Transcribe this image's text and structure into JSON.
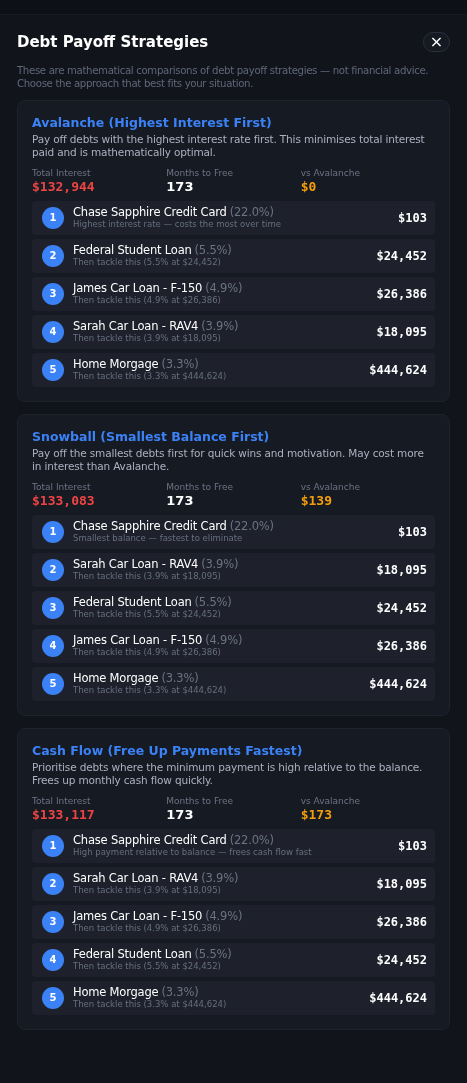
{
  "dialog": {
    "title": "Debt Payoff Strategies",
    "close": "×",
    "subtitle": "These are mathematical comparisons of debt payoff strategies — not financial advice. Choose the approach that best fits your situation."
  },
  "strategies": [
    {
      "title": "Avalanche (Highest Interest First)",
      "description": "Pay off debts with the highest interest rate first. This minimises total interest paid and is mathematically optimal.",
      "stats": [
        {
          "label": "Total Interest",
          "value": "$132,944",
          "kind": "cost"
        },
        {
          "label": "Months to Free",
          "value": "173",
          "kind": "plain"
        },
        {
          "label": "vs Avalanche",
          "value": "$0",
          "kind": "diff"
        }
      ],
      "debts": [
        {
          "order": "1",
          "name": "Chase Sapphire Credit Card",
          "rate": "(22.0%)",
          "note": "Highest interest rate — costs the most over time",
          "amount": "$103"
        },
        {
          "order": "2",
          "name": "Federal Student Loan",
          "rate": "(5.5%)",
          "note": "Then tackle this (5.5% at $24,452)",
          "amount": "$24,452"
        },
        {
          "order": "3",
          "name": "James Car Loan - F-150",
          "rate": "(4.9%)",
          "note": "Then tackle this (4.9% at $26,386)",
          "amount": "$26,386"
        },
        {
          "order": "4",
          "name": "Sarah Car Loan - RAV4",
          "rate": "(3.9%)",
          "note": "Then tackle this (3.9% at $18,095)",
          "amount": "$18,095"
        },
        {
          "order": "5",
          "name": "Home Morgage",
          "rate": "(3.3%)",
          "note": "Then tackle this (3.3% at $444,624)",
          "amount": "$444,624"
        }
      ]
    },
    {
      "title": "Snowball (Smallest Balance First)",
      "description": "Pay off the smallest debts first for quick wins and motivation. May cost more in interest than Avalanche.",
      "stats": [
        {
          "label": "Total Interest",
          "value": "$133,083",
          "kind": "cost"
        },
        {
          "label": "Months to Free",
          "value": "173",
          "kind": "plain"
        },
        {
          "label": "vs Avalanche",
          "value": "$139",
          "kind": "diff"
        }
      ],
      "debts": [
        {
          "order": "1",
          "name": "Chase Sapphire Credit Card",
          "rate": "(22.0%)",
          "note": "Smallest balance — fastest to eliminate",
          "amount": "$103"
        },
        {
          "order": "2",
          "name": "Sarah Car Loan - RAV4",
          "rate": "(3.9%)",
          "note": "Then tackle this (3.9% at $18,095)",
          "amount": "$18,095"
        },
        {
          "order": "3",
          "name": "Federal Student Loan",
          "rate": "(5.5%)",
          "note": "Then tackle this (5.5% at $24,452)",
          "amount": "$24,452"
        },
        {
          "order": "4",
          "name": "James Car Loan - F-150",
          "rate": "(4.9%)",
          "note": "Then tackle this (4.9% at $26,386)",
          "amount": "$26,386"
        },
        {
          "order": "5",
          "name": "Home Morgage",
          "rate": "(3.3%)",
          "note": "Then tackle this (3.3% at $444,624)",
          "amount": "$444,624"
        }
      ]
    },
    {
      "title": "Cash Flow (Free Up Payments Fastest)",
      "description": "Prioritise debts where the minimum payment is high relative to the balance. Frees up monthly cash flow quickly.",
      "stats": [
        {
          "label": "Total Interest",
          "value": "$133,117",
          "kind": "cost"
        },
        {
          "label": "Months to Free",
          "value": "173",
          "kind": "plain"
        },
        {
          "label": "vs Avalanche",
          "value": "$173",
          "kind": "diff"
        }
      ],
      "debts": [
        {
          "order": "1",
          "name": "Chase Sapphire Credit Card",
          "rate": "(22.0%)",
          "note": "High payment relative to balance — frees cash flow fast",
          "amount": "$103"
        },
        {
          "order": "2",
          "name": "Sarah Car Loan - RAV4",
          "rate": "(3.9%)",
          "note": "Then tackle this (3.9% at $18,095)",
          "amount": "$18,095"
        },
        {
          "order": "3",
          "name": "James Car Loan - F-150",
          "rate": "(4.9%)",
          "note": "Then tackle this (4.9% at $26,386)",
          "amount": "$26,386"
        },
        {
          "order": "4",
          "name": "Federal Student Loan",
          "rate": "(5.5%)",
          "note": "Then tackle this (5.5% at $24,452)",
          "amount": "$24,452"
        },
        {
          "order": "5",
          "name": "Home Morgage",
          "rate": "(3.3%)",
          "note": "Then tackle this (3.3% at $444,624)",
          "amount": "$444,624"
        }
      ]
    }
  ]
}
